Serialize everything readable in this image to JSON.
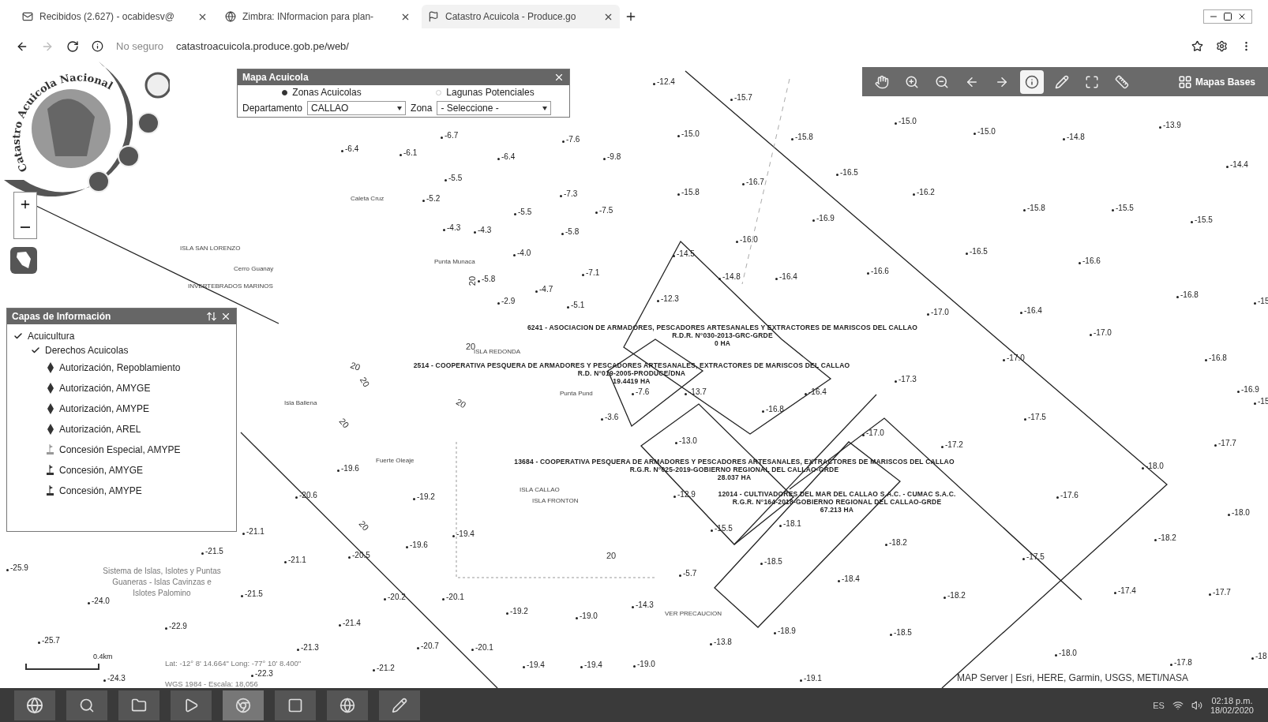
{
  "browser": {
    "tabs": [
      {
        "title": "Recibidos (2.627) - ocabidesv@",
        "selected": false
      },
      {
        "title": "Zimbra: INformacion para plan-",
        "selected": false
      },
      {
        "title": "Catastro Acuicola - Produce.go",
        "selected": true
      }
    ],
    "security": "No seguro",
    "url": "catastroacuicola.produce.gob.pe/web/"
  },
  "logo": {
    "text": "Catastro Acuicola Nacional"
  },
  "mapa_panel": {
    "title": "Mapa Acuicola",
    "options": [
      {
        "label": "Zonas Acuicolas",
        "selected": true
      },
      {
        "label": "Lagunas Potenciales",
        "selected": false
      }
    ],
    "departamento_label": "Departamento",
    "departamento": "CALLAO",
    "zona_label": "Zona",
    "zona": "- Seleccione -"
  },
  "toolbar": {
    "tools": [
      {
        "kind": "pan",
        "selected": false
      },
      {
        "kind": "zoomin",
        "selected": false
      },
      {
        "kind": "zoomout",
        "selected": false
      },
      {
        "kind": "back",
        "selected": false
      },
      {
        "kind": "forward",
        "selected": false
      },
      {
        "kind": "info",
        "selected": true
      },
      {
        "kind": "draw",
        "selected": false
      },
      {
        "kind": "extent",
        "selected": false
      },
      {
        "kind": "measure",
        "selected": false
      }
    ],
    "basemaps": "Mapas Bases"
  },
  "layers_panel": {
    "title": "Capas de Información",
    "tree": [
      {
        "label": "Acuicultura",
        "checked": true,
        "children": [
          {
            "label": "Derechos Acuicolas",
            "checked": true,
            "children": [
              {
                "label": "Autorización, Repoblamiento",
                "kind": "diamond"
              },
              {
                "label": "Autorización, AMYGE",
                "kind": "diamond"
              },
              {
                "label": "Autorización, AMYPE",
                "kind": "diamond"
              },
              {
                "label": "Autorización, AREL",
                "kind": "diamond"
              },
              {
                "label": "Concesión Especial, AMYPE",
                "kind": "flag-light"
              },
              {
                "label": "Concesión, AMYGE",
                "kind": "flag"
              },
              {
                "label": "Concesión, AMYPE",
                "kind": "flag"
              }
            ]
          }
        ]
      }
    ]
  },
  "soundings": [
    "-6.4",
    "-6.1",
    "-6.7",
    "-6.4",
    "-7.6",
    "-9.8",
    "-5.5",
    "-5.2",
    "-7.3",
    "-5.5",
    "-7.5",
    "-4.3",
    "-4.3",
    "-5.8",
    "-4.0",
    "-5.8",
    "-7.1",
    "-4.7",
    "-2.9",
    "-5.1",
    "-12.4",
    "-15.7",
    "-15.0",
    "-15.8",
    "-16.5",
    "-15.0",
    "-15.0",
    "-14.8",
    "-13.9",
    "-14.4",
    "-15.8",
    "-16.7",
    "-16.2",
    "-15.8",
    "-15.5",
    "-15.5",
    "-16.9",
    "-16.0",
    "-16.5",
    "-16.6",
    "-14.5",
    "-14.8",
    "-16.4",
    "-16.6",
    "-12.3",
    "-17.0",
    "-16.4",
    "-16.8",
    "-15",
    "-17.0",
    "-17.0",
    "-16.8",
    "-17.3",
    "-7.6",
    "-13.7",
    "-16.4",
    "-16.8",
    "-3.6",
    "-13.0",
    "-17.0",
    "-17.2",
    "-16.9",
    "-15",
    "-17.5",
    "-17.7",
    "-18.0",
    "-12.9",
    "-15.5",
    "-18.1",
    "-17.6",
    "-18.0",
    "-18.2",
    "-18.2",
    "-17.5",
    "-18.5",
    "-18.4",
    "-5.7",
    "-17.4",
    "-17.7",
    "-18.2",
    "-14.3",
    "-18.9",
    "-18.5",
    "-13.8",
    "-18.0",
    "-17.8",
    "-18",
    "-19.0",
    "-19.1",
    "-19.6",
    "-20.6",
    "-19.2",
    "-21.1",
    "-19.4",
    "-19.6",
    "-21.5",
    "-21.1",
    "-20.5",
    "-25.9",
    "-24.0",
    "-21.5",
    "-20.2",
    "-20.1",
    "-19.2",
    "-19.0",
    "-22.9",
    "-21.4",
    "-25.7",
    "-21.3",
    "-20.7",
    "-20.1",
    "-19.4",
    "-19.4",
    "-24.3",
    "-22.3",
    "-21.2"
  ],
  "places": [
    "Caleta Cruz",
    "ISLA SAN LORENZO",
    "Cerro Guanay",
    "INVERTEBRADOS MARINOS",
    "Punta Munaca",
    "ISLA REDONDA",
    "Isla Ballena",
    "Punta Pund",
    "Fuerte Oleaje",
    "ISLA CALLAO",
    "ISLA FRONTON",
    "VER PRECAUCION",
    "Sistema de Islas, Islotes y Puntas Guaneras - Islas Cavinzas e Islotes Palomino"
  ],
  "contours": [
    "20",
    "20",
    "20",
    "20",
    "20",
    "20",
    "20",
    "20"
  ],
  "concessions": [
    {
      "name": "6241 - ASOCIACION DE ARMADORES, PESCADORES ARTESANALES Y EXTRACTORES DE MARISCOS DEL CALLAO",
      "resolution": "R.D.R. N°030-2013-GRC-GRDE",
      "area": "0 HA"
    },
    {
      "name": "2514 - COOPERATIVA PESQUERA DE ARMADORES Y PESCADORES ARTESANALES, EXTRACTORES DE MARISCOS DEL CALLAO",
      "resolution": "R.D. N°019-2005-PRODUCE/DNA",
      "area": "19.4419 HA"
    },
    {
      "name": "13684 - COOPERATIVA PESQUERA DE ARMADORES Y PESCADORES ARTESANALES, EXTRACTORES DE MARISCOS DEL CALLAO",
      "resolution": "R.G.R. N°025-2019-GOBIERNO REGIONAL DEL CALLAO-GRDE",
      "area": "28.037 HA"
    },
    {
      "name": "12014 - CULTIVADORES DEL MAR DEL CALLAO S.A.C. - CUMAC S.A.C.",
      "resolution": "R.G.R. N°164-2018-GOBIERNO REGIONAL DEL CALLAO-GRDE",
      "area": "67.213 HA"
    }
  ],
  "scale": "0.4km",
  "coordinates": "Lat: -12° 8' 14.664\" Long: -77° 10' 8.400\"",
  "projection": "WGS 1984 - Escala: 18,056",
  "attribution": "MAP Server | Esri, HERE, Garmin, USGS, METI/NASA",
  "taskbar": {
    "language": "ES",
    "time": "02:18 p.m.",
    "date": "18/02/2020"
  }
}
